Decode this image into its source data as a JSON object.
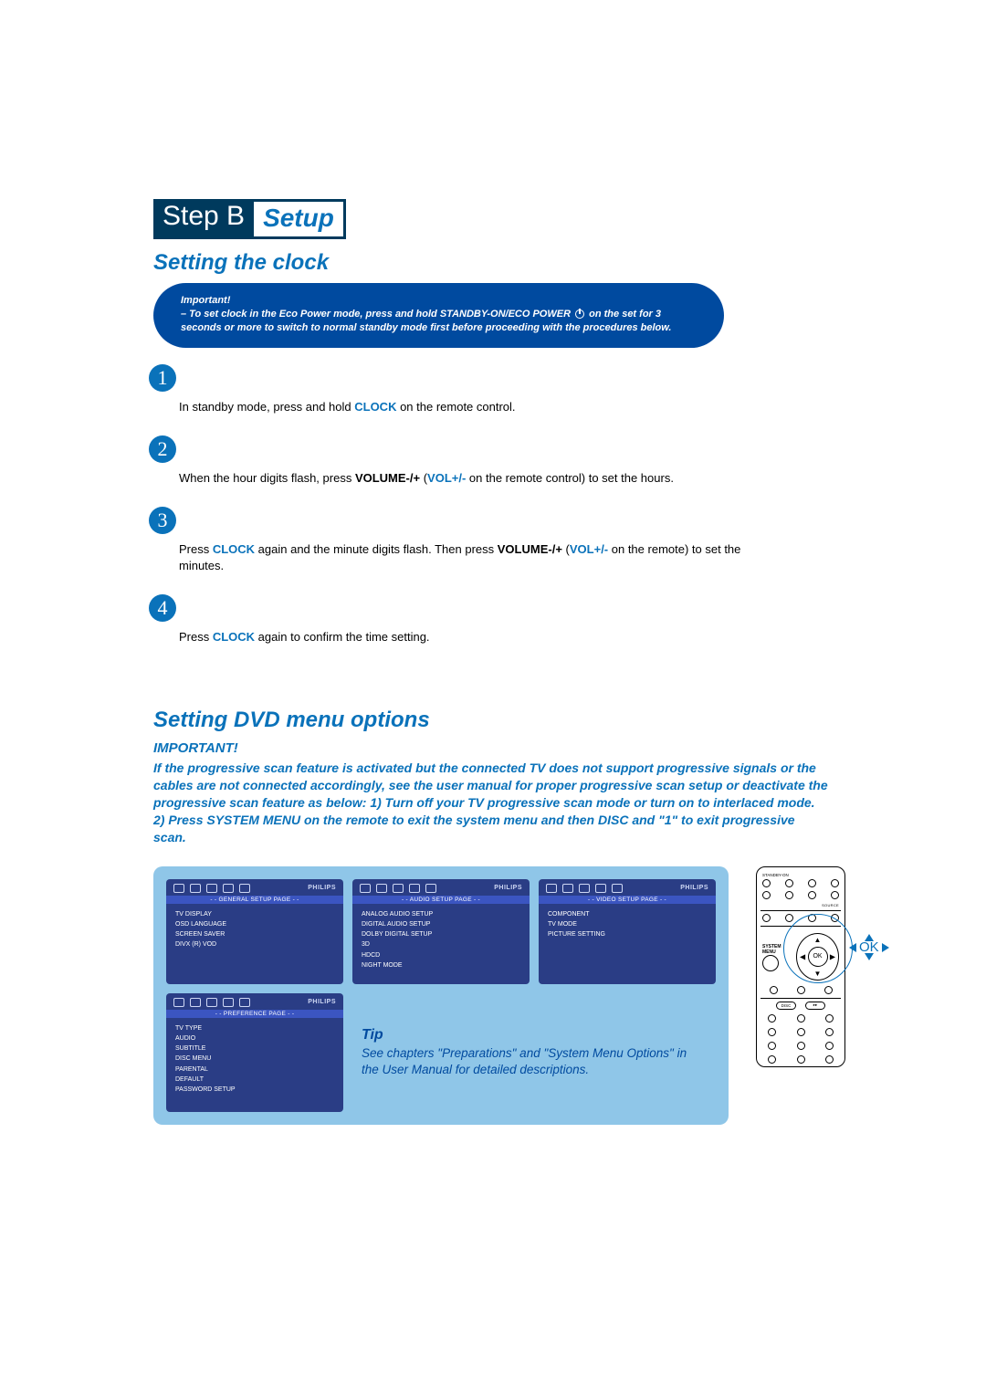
{
  "step_header": {
    "dark": "Step B",
    "light": "Setup"
  },
  "section1_title": "Setting the clock",
  "important_bubble": {
    "label": "Important!",
    "body_before": "– To set clock in the Eco Power mode, press and hold STANDBY-ON/ECO POWER ",
    "body_after": " on the set for 3 seconds or more to switch to normal standby mode first before proceeding with the procedures below."
  },
  "steps": [
    {
      "n": "1",
      "pre": "In standby mode, press and hold ",
      "kw1": "CLOCK",
      "post1": " on the remote control."
    },
    {
      "n": "2",
      "pre": "When the hour digits flash, press ",
      "bold1": "VOLUME-/+",
      "mid1": " (",
      "kw1": "VOL+/-",
      "post1": " on the remote control) to set the hours."
    },
    {
      "n": "3",
      "pre": "Press ",
      "kw1": "CLOCK",
      "mid1": " again and the minute digits flash. Then press ",
      "bold1": "VOLUME-/+",
      "mid2": " (",
      "kw2": "VOL+/-",
      "post1": " on the remote) to set the minutes."
    },
    {
      "n": "4",
      "pre": "Press ",
      "kw1": "CLOCK",
      "post1": " again to confirm the time setting."
    }
  ],
  "section2_title": "Setting DVD menu options",
  "important2_label": "IMPORTANT!",
  "important2_body": "If the progressive scan feature is activated but the connected TV does not support progressive signals or the cables are not connected accordingly, see the user manual for proper progressive scan setup or deactivate the progressive scan feature as below:\n1) Turn off your TV progressive scan mode or turn on to interlaced mode.\n2) Press SYSTEM MENU on the remote to exit the system menu and then DISC and \"1\" to exit progressive scan.",
  "menu_panels": {
    "brand": "PHILIPS",
    "general": {
      "title": "- - GENERAL  SETUP  PAGE - -",
      "items": [
        "TV DISPLAY",
        "OSD LANGUAGE",
        "SCREEN SAVER",
        "DIVX (R) VOD"
      ]
    },
    "audio": {
      "title": "- - AUDIO  SETUP PAGE - -",
      "items": [
        "ANALOG AUDIO SETUP",
        "DIGITAL AUDIO SETUP",
        "DOLBY DIGITAL SETUP",
        "3D",
        "HDCD",
        "NIGHT MODE"
      ]
    },
    "video": {
      "title": "- - VIDEO  SETUP PAGE - -",
      "items": [
        "COMPONENT",
        "TV MODE",
        "PICTURE SETTING"
      ]
    },
    "pref": {
      "title": "- - PREFERENCE  PAGE - -",
      "items": [
        "TV TYPE",
        "AUDIO",
        "SUBTITLE",
        "DISC MENU",
        "PARENTAL",
        "DEFAULT",
        "PASSWORD SETUP"
      ]
    }
  },
  "tip": {
    "label": "Tip",
    "body": "See chapters \"Preparations\" and \"System Menu Options\" in the User Manual for detailed descriptions."
  },
  "remote": {
    "system_menu": "SYSTEM MENU",
    "ok": "OK",
    "standby": "STANDBY-ON",
    "source": "SOURCE",
    "disc": "DISC",
    "pill2": "▸▸"
  },
  "ok_highlight": "OK"
}
